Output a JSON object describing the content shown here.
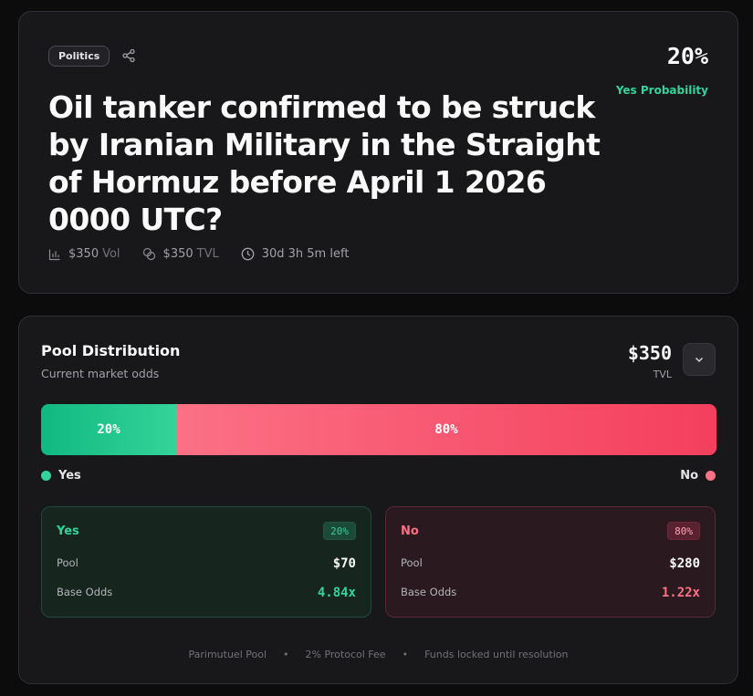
{
  "market": {
    "category": "Politics",
    "title": "Oil tanker confirmed to be struck by Iranian Military in the Straight of Hormuz before April 1 2026 0000 UTC?",
    "probability": "20%",
    "probability_label": "Yes Probability",
    "stats": {
      "vol_value": "$350",
      "vol_label": "Vol",
      "tvl_value": "$350",
      "tvl_label": "TVL",
      "time_left": "30d 3h 5m left"
    }
  },
  "pool": {
    "title": "Pool Distribution",
    "subtitle": "Current market odds",
    "tvl_value": "$350",
    "tvl_label": "TVL",
    "bar": {
      "yes_pct": "20%",
      "no_pct": "80%",
      "yes_fraction": 0.2
    },
    "legend": {
      "yes": "Yes",
      "no": "No"
    },
    "yes": {
      "name": "Yes",
      "pct": "20%",
      "pool_label": "Pool",
      "pool_value": "$70",
      "odds_label": "Base Odds",
      "odds_value": "4.84x"
    },
    "no": {
      "name": "No",
      "pct": "80%",
      "pool_label": "Pool",
      "pool_value": "$280",
      "odds_label": "Base Odds",
      "odds_value": "1.22x"
    },
    "footer": [
      "Parimutuel Pool",
      "2% Protocol Fee",
      "Funds locked until resolution"
    ]
  },
  "colors": {
    "yes": "#34d399",
    "no": "#fb7185",
    "background": "#18181b"
  },
  "icons": {
    "share": "share-icon",
    "volume": "bar-chart-icon",
    "tvl": "coins-icon",
    "time": "clock-icon",
    "expand": "chevron-down-icon"
  }
}
